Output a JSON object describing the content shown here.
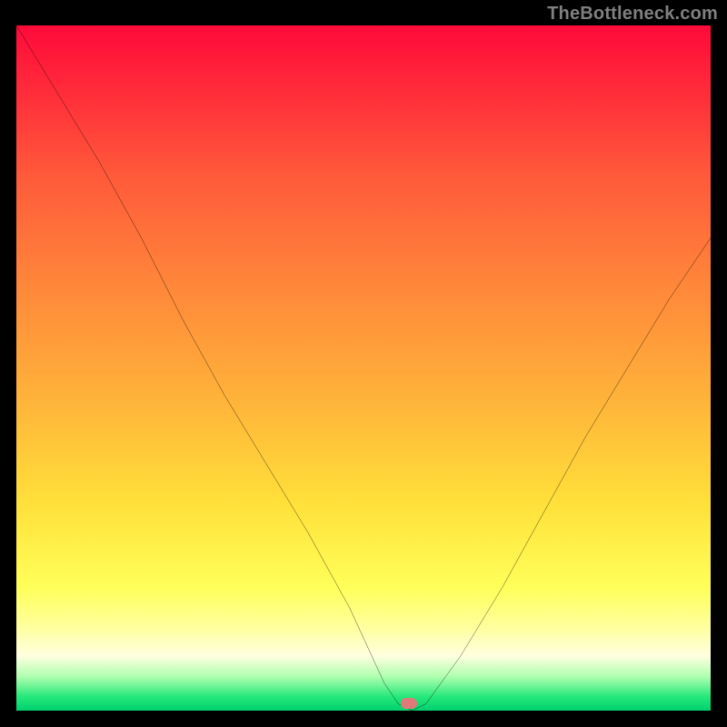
{
  "watermark": {
    "text": "TheBottleneck.com"
  },
  "marker": {
    "x_pct": 56.5,
    "y_pct": 99.0
  },
  "chart_data": {
    "type": "line",
    "title": "",
    "xlabel": "",
    "ylabel": "",
    "xlim": [
      0,
      100
    ],
    "ylim": [
      0,
      100
    ],
    "x": [
      0,
      6,
      12,
      18,
      24,
      30,
      36,
      42,
      48,
      53,
      55,
      57,
      59,
      64,
      70,
      76,
      82,
      88,
      94,
      100
    ],
    "values": [
      100,
      90,
      80,
      69,
      57,
      46,
      36,
      26,
      15,
      4,
      1,
      0,
      1,
      8,
      18,
      29,
      40,
      50,
      60,
      69
    ],
    "legend_position": "none",
    "grid": false,
    "gradient_background": true
  }
}
